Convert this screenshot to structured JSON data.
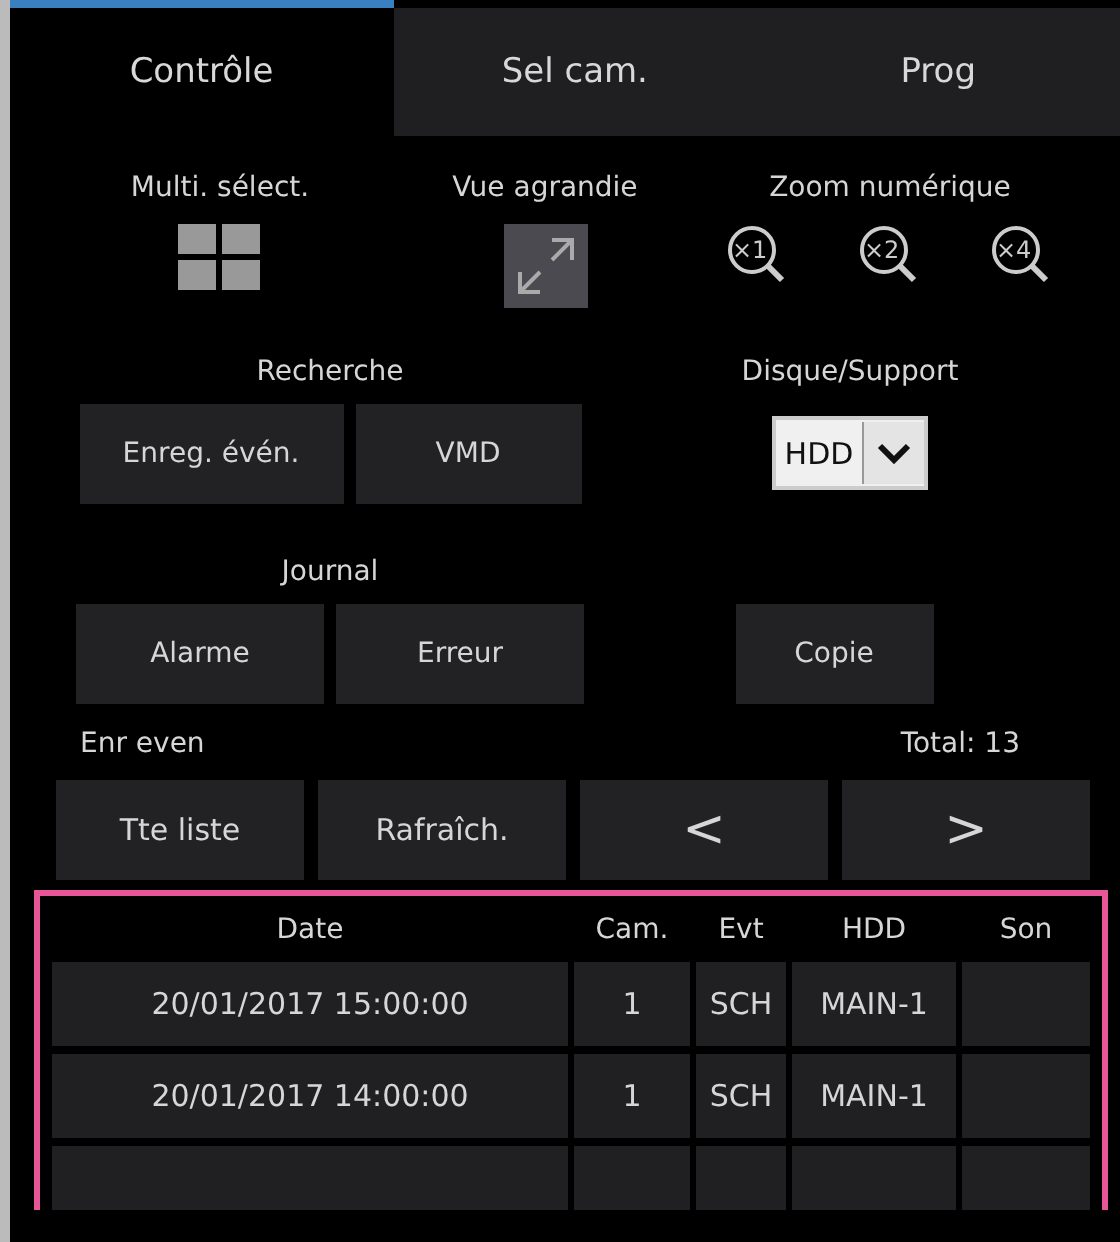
{
  "tabs": [
    {
      "label": "Contrôle",
      "selected": true
    },
    {
      "label": "Sel cam.",
      "selected": false
    },
    {
      "label": "Prog",
      "selected": false
    }
  ],
  "view": {
    "multi_label": "Multi. sélect.",
    "enlarge_label": "Vue agrandie",
    "zoom_label": "Zoom numérique",
    "zoom_buttons": [
      "×1",
      "×2",
      "×4"
    ]
  },
  "search": {
    "label": "Recherche",
    "buttons": [
      "Enreg. évén.",
      "VMD"
    ]
  },
  "media": {
    "label": "Disque/Support",
    "value": "HDD"
  },
  "log": {
    "label": "Journal",
    "buttons": [
      "Alarme",
      "Erreur"
    ]
  },
  "copy_button": "Copie",
  "events": {
    "label": "Enr even",
    "total": "Total:  13",
    "buttons": [
      "Tte liste",
      "Rafraîch."
    ],
    "prev": "<",
    "next": ">"
  },
  "table": {
    "columns": [
      "Date",
      "Cam.",
      "Evt",
      "HDD",
      "Son"
    ],
    "rows": [
      [
        "20/01/2017  15:00:00",
        "1",
        "SCH",
        "MAIN-1",
        ""
      ],
      [
        "20/01/2017  14:00:00",
        "1",
        "SCH",
        "MAIN-1",
        ""
      ]
    ]
  }
}
